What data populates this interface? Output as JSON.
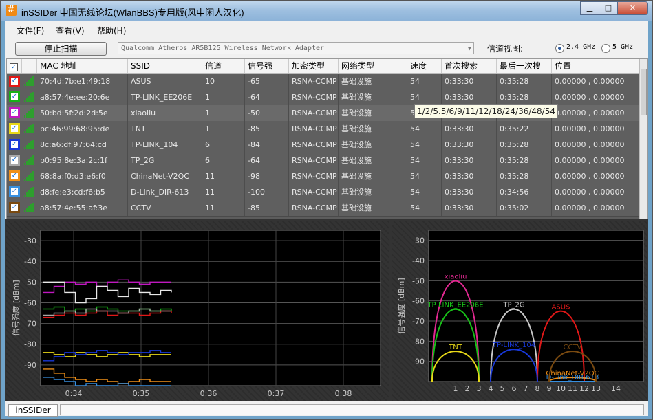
{
  "window": {
    "title": "inSSIDer 中国无线论坛(WlanBBS)专用版(风中闲人汉化)",
    "icon": "#"
  },
  "menu": {
    "file": "文件(F)",
    "view": "查看(V)",
    "help": "帮助(H)"
  },
  "toolbar": {
    "stop_button": "停止扫描",
    "adapter": "Qualcomm Atheros AR5B125 Wireless Network Adapter",
    "channel_view_label": "信道视图:",
    "band_24": "2.4 GHz",
    "band_5": "5 GHz",
    "selected_band": "2.4 GHz"
  },
  "table": {
    "headers": [
      "MAC 地址",
      "SSID",
      "信道",
      "信号强",
      "加密类型",
      "网络类型",
      "速度",
      "首次搜索",
      "最后一次搜",
      "位置"
    ],
    "rows": [
      {
        "color": "#e01818",
        "mac": "70:4d:7b:e1:49:18",
        "ssid": "ASUS",
        "channel": "10",
        "rssi": "-65",
        "security": "RSNA-CCMP",
        "network": "基础设施",
        "speed": "54",
        "first": "0:33:30",
        "last": "0:35:28",
        "location": "0.00000 , 0.00000"
      },
      {
        "color": "#18b018",
        "mac": "a8:57:4e:ee:20:6e",
        "ssid": "TP-LINK_EE206E",
        "channel": "1",
        "rssi": "-64",
        "security": "RSNA-CCMP",
        "network": "基础设施",
        "speed": "54",
        "first": "0:33:30",
        "last": "0:35:28",
        "location": "0.00000 , 0.00000"
      },
      {
        "color": "#c018c0",
        "mac": "50:bd:5f:2d:2d:5e",
        "ssid": "xiaoliu",
        "channel": "1",
        "rssi": "-50",
        "security": "RSNA-CCMP",
        "network": "基础设施",
        "speed": "5",
        "first": "",
        "last": "",
        "location": "0.00000 , 0.00000"
      },
      {
        "color": "#e8d818",
        "mac": "bc:46:99:68:95:de",
        "ssid": "TNT",
        "channel": "1",
        "rssi": "-85",
        "security": "RSNA-CCMP",
        "network": "基础设施",
        "speed": "54",
        "first": "0:33:30",
        "last": "0:35:22",
        "location": "0.00000 , 0.00000"
      },
      {
        "color": "#1838d8",
        "mac": "8c:a6:df:97:64:cd",
        "ssid": "TP-LINK_104",
        "channel": "6",
        "rssi": "-84",
        "security": "RSNA-CCMP",
        "network": "基础设施",
        "speed": "54",
        "first": "0:33:30",
        "last": "0:35:28",
        "location": "0.00000 , 0.00000"
      },
      {
        "color": "#a8a8a8",
        "mac": "b0:95:8e:3a:2c:1f",
        "ssid": "TP_2G",
        "channel": "6",
        "rssi": "-64",
        "security": "RSNA-CCMP",
        "network": "基础设施",
        "speed": "54",
        "first": "0:33:30",
        "last": "0:35:28",
        "location": "0.00000 , 0.00000"
      },
      {
        "color": "#f09018",
        "mac": "68:8a:f0:d3:e6:f0",
        "ssid": "ChinaNet-V2QC",
        "channel": "11",
        "rssi": "-98",
        "security": "RSNA-CCMP",
        "network": "基础设施",
        "speed": "54",
        "first": "0:33:30",
        "last": "0:35:28",
        "location": "0.00000 , 0.00000"
      },
      {
        "color": "#3890e0",
        "mac": "d8:fe:e3:cd:f6:b5",
        "ssid": "D-Link_DIR-613",
        "channel": "11",
        "rssi": "-100",
        "security": "RSNA-CCMP",
        "network": "基础设施",
        "speed": "54",
        "first": "0:33:30",
        "last": "0:34:56",
        "location": "0.00000 , 0.00000"
      },
      {
        "color": "#7a4a10",
        "mac": "a8:57:4e:55:af:3e",
        "ssid": "CCTV",
        "channel": "11",
        "rssi": "-85",
        "security": "RSNA-CCMP",
        "network": "基础设施",
        "speed": "54",
        "first": "0:33:30",
        "last": "0:35:02",
        "location": "0.00000 , 0.00000"
      }
    ]
  },
  "tooltip": "1/2/5.5/6/9/11/12/18/24/36/48/54",
  "chart_data": [
    {
      "type": "line",
      "title": "",
      "ylabel": "信号强度 [dBm]",
      "ylim": [
        -100,
        -25
      ],
      "yticks": [
        -30,
        -40,
        -50,
        -60,
        -70,
        -80,
        -90
      ],
      "xticks": [
        "0:34",
        "0:35",
        "0:36",
        "0:37",
        "0:38"
      ],
      "grid": true,
      "series": [
        {
          "color": "#e01818",
          "values": [
            -67,
            -66,
            -65,
            -66,
            -65,
            -64,
            -66,
            -65,
            -65,
            -66,
            -65,
            -64,
            -65
          ]
        },
        {
          "color": "#18b018",
          "values": [
            -63,
            -62,
            -64,
            -63,
            -64,
            -62,
            -63,
            -64,
            -64,
            -63,
            -64,
            -63,
            -64
          ]
        },
        {
          "color": "#c018c0",
          "values": [
            -55,
            -52,
            -50,
            -51,
            -50,
            -52,
            -50,
            -49,
            -50,
            -51,
            -50,
            -50,
            -50
          ]
        },
        {
          "color": "#e8d818",
          "values": [
            -84,
            -85,
            -86,
            -84,
            -85,
            -86,
            -85,
            -84,
            -85,
            -86,
            -85,
            -85,
            -85
          ]
        },
        {
          "color": "#1838d8",
          "values": [
            -88,
            -86,
            -84,
            -85,
            -84,
            -83,
            -84,
            -85,
            -84,
            -84,
            -83,
            -84,
            -84
          ]
        },
        {
          "color": "#a8a8a8",
          "values": [
            -66,
            -65,
            -64,
            -65,
            -63,
            -64,
            -64,
            -65,
            -64,
            -63,
            -64,
            -64,
            -64
          ]
        },
        {
          "color": "#f09018",
          "values": [
            -92,
            -94,
            -96,
            -97,
            -98,
            -97,
            -98,
            -99,
            -98,
            -97,
            -98,
            -98,
            -98
          ]
        },
        {
          "color": "#3890e0",
          "values": [
            -96,
            -97,
            -98,
            -100,
            -99,
            -100,
            -100,
            -99,
            -100,
            -100,
            -100,
            -100,
            -100
          ]
        },
        {
          "color": "#e8e8e8",
          "values": [
            -50,
            -50,
            -55,
            -60,
            -58,
            -52,
            -54,
            -57,
            -53,
            -55,
            -56,
            -54,
            -55
          ]
        }
      ]
    },
    {
      "type": "area",
      "title": "",
      "ylabel": "信号强度 [dBm]",
      "ylim": [
        -100,
        -25
      ],
      "yticks": [
        -30,
        -40,
        -50,
        -60,
        -70,
        -80,
        -90
      ],
      "xticks": [
        "1",
        "2",
        "3",
        "4",
        "5",
        "6",
        "7",
        "8",
        "9",
        "10",
        "11",
        "12",
        "13",
        "14"
      ],
      "series": [
        {
          "name": "xiaoliu",
          "color": "#e02890",
          "channel": 1,
          "rssi": -50
        },
        {
          "name": "TP-LINK_EE206E",
          "color": "#18c018",
          "channel": 1,
          "rssi": -64
        },
        {
          "name": "TP_2G",
          "color": "#c8c8c8",
          "channel": 6,
          "rssi": -64
        },
        {
          "name": "ASUS",
          "color": "#e01818",
          "channel": 10,
          "rssi": -65
        },
        {
          "name": "TP-LINK_104",
          "color": "#1838d8",
          "channel": 6,
          "rssi": -84
        },
        {
          "name": "TNT",
          "color": "#e8d818",
          "channel": 1,
          "rssi": -85
        },
        {
          "name": "ChinaNet-V2QC",
          "color": "#f09018",
          "channel": 11,
          "rssi": -98
        },
        {
          "name": "D-Link_DIR-613",
          "color": "#3890e0",
          "channel": 11,
          "rssi": -100
        },
        {
          "name": "CCTV",
          "color": "#7a4a10",
          "channel": 11,
          "rssi": -85
        }
      ]
    }
  ],
  "statusbar": {
    "tab": "inSSIDer"
  }
}
